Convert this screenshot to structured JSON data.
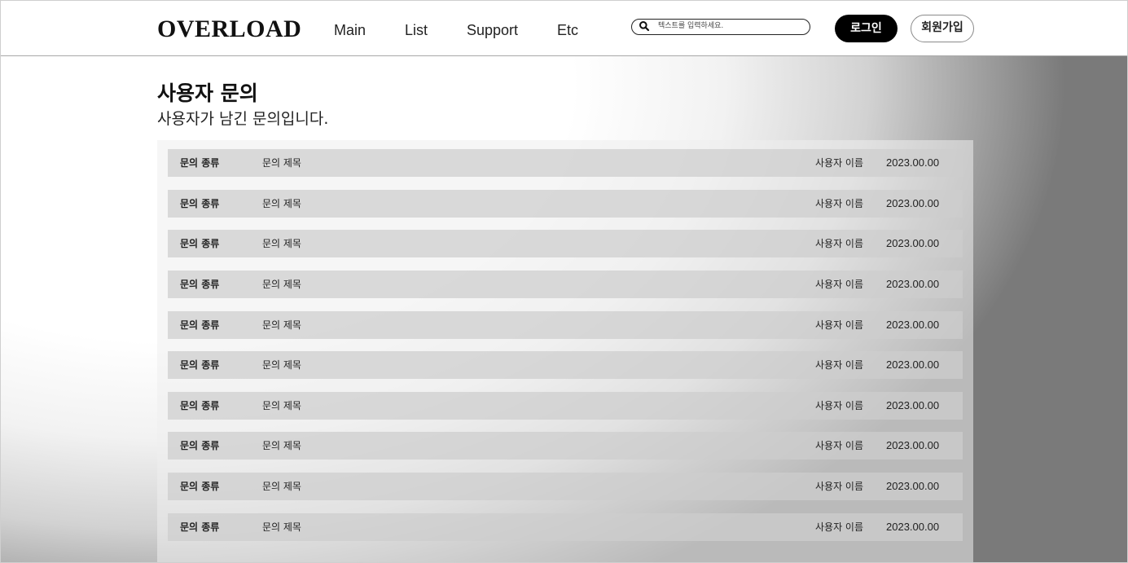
{
  "header": {
    "logo": "OVERLOAD",
    "nav": [
      "Main",
      "List",
      "Support",
      "Etc"
    ],
    "search_placeholder": "텍스트를 입력하세요.",
    "login_label": "로그인",
    "signup_label": "회원가입"
  },
  "main": {
    "title": "사용자 문의",
    "subtitle": "사용자가 남긴 문의입니다."
  },
  "inquiries": [
    {
      "type": "문의 종류",
      "title": "문의 제목",
      "user": "사용자 이름",
      "date": "2023.00.00"
    },
    {
      "type": "문의 종류",
      "title": "문의 제목",
      "user": "사용자 이름",
      "date": "2023.00.00"
    },
    {
      "type": "문의 종류",
      "title": "문의 제목",
      "user": "사용자 이름",
      "date": "2023.00.00"
    },
    {
      "type": "문의 종류",
      "title": "문의 제목",
      "user": "사용자 이름",
      "date": "2023.00.00"
    },
    {
      "type": "문의 종류",
      "title": "문의 제목",
      "user": "사용자 이름",
      "date": "2023.00.00"
    },
    {
      "type": "문의 종류",
      "title": "문의 제목",
      "user": "사용자 이름",
      "date": "2023.00.00"
    },
    {
      "type": "문의 종류",
      "title": "문의 제목",
      "user": "사용자 이름",
      "date": "2023.00.00"
    },
    {
      "type": "문의 종류",
      "title": "문의 제목",
      "user": "사용자 이름",
      "date": "2023.00.00"
    },
    {
      "type": "문의 종류",
      "title": "문의 제목",
      "user": "사용자 이름",
      "date": "2023.00.00"
    },
    {
      "type": "문의 종류",
      "title": "문의 제목",
      "user": "사용자 이름",
      "date": "2023.00.00"
    }
  ],
  "icons": {
    "search": "search-icon"
  },
  "colors": {
    "accent": "#000000",
    "row_bg": "#d4d4d4"
  }
}
